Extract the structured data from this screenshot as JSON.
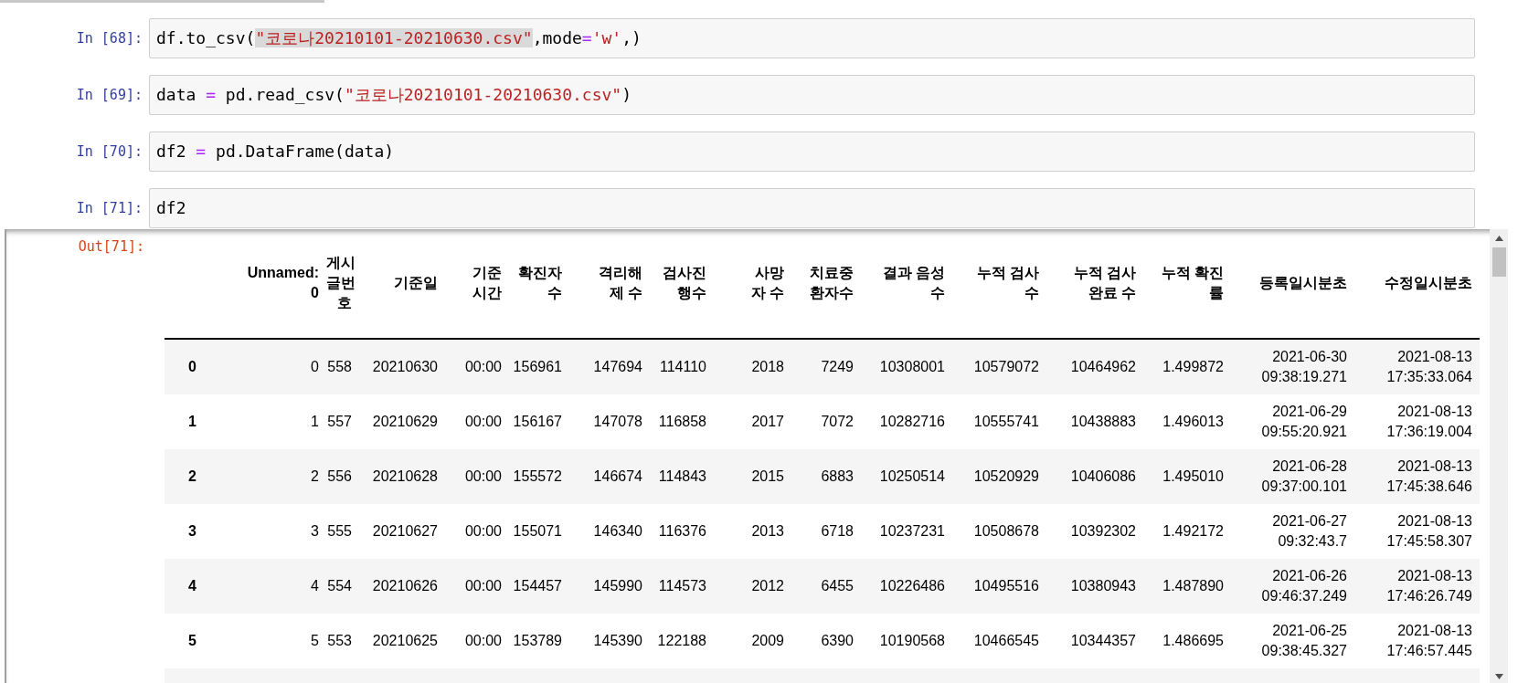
{
  "input_cells": [
    {
      "prompt": "In [68]:",
      "code": [
        {
          "t": "df.to_csv(",
          "kind": "plain",
          "highlighted": false
        },
        {
          "t": "\"코로나20210101-20210630.csv\"",
          "kind": "string",
          "highlighted": true
        },
        {
          "t": ",mode",
          "kind": "plain",
          "highlighted": false
        },
        {
          "t": "=",
          "kind": "operator",
          "highlighted": false
        },
        {
          "t": "'w'",
          "kind": "string",
          "highlighted": false
        },
        {
          "t": ",)",
          "kind": "plain",
          "highlighted": false
        }
      ]
    },
    {
      "prompt": "In [69]:",
      "code": [
        {
          "t": "data ",
          "kind": "plain",
          "highlighted": false
        },
        {
          "t": "=",
          "kind": "operator",
          "highlighted": false
        },
        {
          "t": " pd.read_csv(",
          "kind": "plain",
          "highlighted": false
        },
        {
          "t": "\"코로나20210101-20210630.csv\"",
          "kind": "string",
          "highlighted": false
        },
        {
          "t": ")",
          "kind": "plain",
          "highlighted": false
        }
      ]
    },
    {
      "prompt": "In [70]:",
      "code": [
        {
          "t": "df2 ",
          "kind": "plain",
          "highlighted": false
        },
        {
          "t": "=",
          "kind": "operator",
          "highlighted": false
        },
        {
          "t": " pd.DataFrame(data)",
          "kind": "plain",
          "highlighted": false
        }
      ]
    },
    {
      "prompt": "In [71]:",
      "code": [
        {
          "t": "df2",
          "kind": "plain",
          "highlighted": false
        }
      ]
    }
  ],
  "output": {
    "prompt": "Out[71]:",
    "table": {
      "columns": [
        {
          "lines": [
            "Unnamed:",
            "0"
          ]
        },
        {
          "lines": [
            "게시",
            "글번",
            "호"
          ]
        },
        {
          "lines": [
            "기준일"
          ]
        },
        {
          "lines": [
            "기준",
            "시간"
          ]
        },
        {
          "lines": [
            "확진자",
            "수"
          ]
        },
        {
          "lines": [
            "격리해",
            "제 수"
          ]
        },
        {
          "lines": [
            "검사진",
            "행수"
          ]
        },
        {
          "lines": [
            "사망",
            "자 수"
          ]
        },
        {
          "lines": [
            "치료중",
            "환자수"
          ]
        },
        {
          "lines": [
            "결과 음성",
            "수"
          ]
        },
        {
          "lines": [
            "누적 검사",
            "수"
          ]
        },
        {
          "lines": [
            "누적 검사",
            "완료 수"
          ]
        },
        {
          "lines": [
            "누적 확진",
            "률"
          ]
        },
        {
          "lines": [
            "등록일시분초"
          ]
        },
        {
          "lines": [
            "수정일시분초"
          ]
        }
      ],
      "rows": [
        {
          "index": "0",
          "cells": [
            "0",
            "558",
            "20210630",
            "00:00",
            "156961",
            "147694",
            "114110",
            "2018",
            "7249",
            "10308001",
            "10579072",
            "10464962",
            "1.499872",
            [
              "2021-06-30",
              "09:38:19.271"
            ],
            [
              "2021-08-13",
              "17:35:33.064"
            ]
          ]
        },
        {
          "index": "1",
          "cells": [
            "1",
            "557",
            "20210629",
            "00:00",
            "156167",
            "147078",
            "116858",
            "2017",
            "7072",
            "10282716",
            "10555741",
            "10438883",
            "1.496013",
            [
              "2021-06-29",
              "09:55:20.921"
            ],
            [
              "2021-08-13",
              "17:36:19.004"
            ]
          ]
        },
        {
          "index": "2",
          "cells": [
            "2",
            "556",
            "20210628",
            "00:00",
            "155572",
            "146674",
            "114843",
            "2015",
            "6883",
            "10250514",
            "10520929",
            "10406086",
            "1.495010",
            [
              "2021-06-28",
              "09:37:00.101"
            ],
            [
              "2021-08-13",
              "17:45:38.646"
            ]
          ]
        },
        {
          "index": "3",
          "cells": [
            "3",
            "555",
            "20210627",
            "00:00",
            "155071",
            "146340",
            "116376",
            "2013",
            "6718",
            "10237231",
            "10508678",
            "10392302",
            "1.492172",
            [
              "2021-06-27",
              "09:32:43.7"
            ],
            [
              "2021-08-13",
              "17:45:58.307"
            ]
          ]
        },
        {
          "index": "4",
          "cells": [
            "4",
            "554",
            "20210626",
            "00:00",
            "154457",
            "145990",
            "114573",
            "2012",
            "6455",
            "10226486",
            "10495516",
            "10380943",
            "1.487890",
            [
              "2021-06-26",
              "09:46:37.249"
            ],
            [
              "2021-08-13",
              "17:46:26.749"
            ]
          ]
        },
        {
          "index": "5",
          "cells": [
            "5",
            "553",
            "20210625",
            "00:00",
            "153789",
            "145390",
            "122188",
            "2009",
            "6390",
            "10190568",
            "10466545",
            "10344357",
            "1.486695",
            [
              "2021-06-25",
              "09:38:45.327"
            ],
            [
              "2021-08-13",
              "17:46:57.445"
            ]
          ]
        }
      ]
    }
  }
}
